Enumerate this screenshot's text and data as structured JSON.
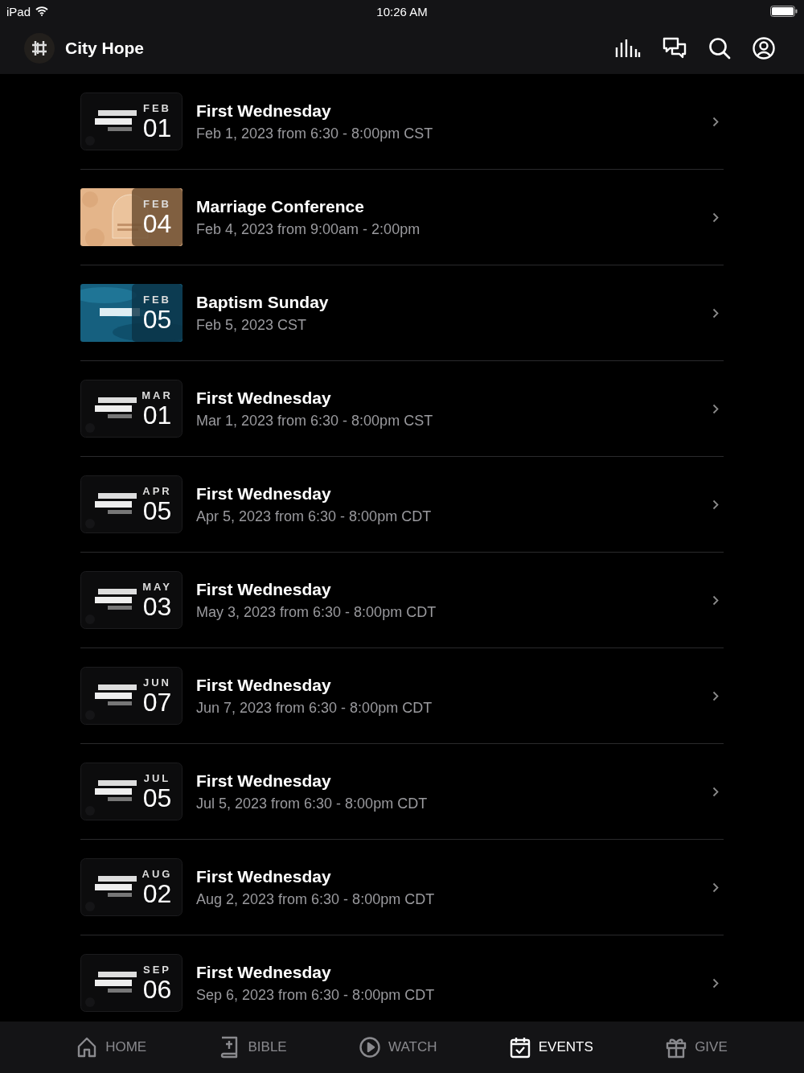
{
  "status_bar": {
    "device": "iPad",
    "time": "10:26 AM"
  },
  "header": {
    "title": "City Hope"
  },
  "events": [
    {
      "kind": "dark",
      "month": "FEB",
      "day": "01",
      "title": "First Wednesday",
      "when": "Feb 1, 2023 from 6:30 - 8:00pm CST"
    },
    {
      "kind": "peach",
      "month": "FEB",
      "day": "04",
      "title": "Marriage Conference",
      "when": "Feb 4, 2023 from 9:00am - 2:00pm"
    },
    {
      "kind": "water",
      "month": "FEB",
      "day": "05",
      "title": "Baptism Sunday",
      "when": "Feb 5, 2023 CST"
    },
    {
      "kind": "dark",
      "month": "MAR",
      "day": "01",
      "title": "First Wednesday",
      "when": "Mar 1, 2023 from 6:30 - 8:00pm CST"
    },
    {
      "kind": "dark",
      "month": "APR",
      "day": "05",
      "title": "First Wednesday",
      "when": "Apr 5, 2023 from 6:30 - 8:00pm CDT"
    },
    {
      "kind": "dark",
      "month": "MAY",
      "day": "03",
      "title": "First Wednesday",
      "when": "May 3, 2023 from 6:30 - 8:00pm CDT"
    },
    {
      "kind": "dark",
      "month": "JUN",
      "day": "07",
      "title": "First Wednesday",
      "when": "Jun 7, 2023 from 6:30 - 8:00pm CDT"
    },
    {
      "kind": "dark",
      "month": "JUL",
      "day": "05",
      "title": "First Wednesday",
      "when": "Jul 5, 2023 from 6:30 - 8:00pm CDT"
    },
    {
      "kind": "dark",
      "month": "AUG",
      "day": "02",
      "title": "First Wednesday",
      "when": "Aug 2, 2023 from 6:30 - 8:00pm CDT"
    },
    {
      "kind": "dark",
      "month": "SEP",
      "day": "06",
      "title": "First Wednesday",
      "when": "Sep 6, 2023 from 6:30 - 8:00pm CDT"
    }
  ],
  "tabs": [
    {
      "kind": "home",
      "label": "HOME",
      "selected": false
    },
    {
      "kind": "bible",
      "label": "BIBLE",
      "selected": false
    },
    {
      "kind": "watch",
      "label": "WATCH",
      "selected": false
    },
    {
      "kind": "events",
      "label": "EVENTS",
      "selected": true
    },
    {
      "kind": "give",
      "label": "GIVE",
      "selected": false
    }
  ]
}
